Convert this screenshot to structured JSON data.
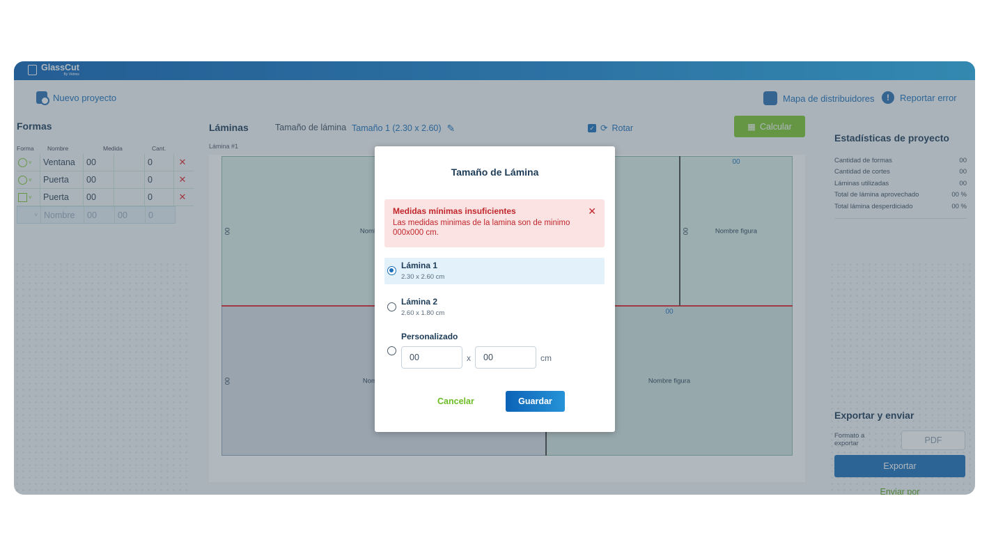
{
  "app": {
    "name": "GlassCut",
    "tagline": "By Vidrios"
  },
  "toolbar": {
    "new_project": "Nuevo proyecto",
    "distributors_map": "Mapa de distribuidores",
    "report_error": "Reportar error"
  },
  "formas": {
    "title": "Formas",
    "headers": {
      "forma": "Forma",
      "nombre": "Nombre",
      "medida": "Medida",
      "cant": "Cant."
    },
    "rows": [
      {
        "shape": "circle",
        "nombre": "Ventana",
        "medida": "00",
        "cant": "0"
      },
      {
        "shape": "circle",
        "nombre": "Puerta",
        "medida": "00",
        "cant": "0"
      },
      {
        "shape": "square",
        "nombre": "Puerta",
        "medida": "00",
        "cant": "0"
      }
    ],
    "new_row": {
      "nombre": "Nombre",
      "medida_a": "00",
      "medida_b": "00",
      "cant": "0"
    }
  },
  "laminas": {
    "title": "Láminas",
    "size_label": "Tamaño de lámina",
    "size_value": "Tamaño 1 (2.30 x 2.60)",
    "rotate": "Rotar",
    "calculate": "Calcular",
    "sheet_label": "Lámina #1",
    "pieces": [
      {
        "top": "00",
        "name": "Nombre figura",
        "side": "00"
      },
      {
        "top": "00",
        "name": "Nombre figura",
        "side": "00"
      },
      {
        "top": "",
        "name": "Nombre figura",
        "side": "00"
      },
      {
        "top": "00",
        "name": "Nombre figura",
        "side": ""
      }
    ]
  },
  "stats": {
    "title": "Estadísticas de proyecto",
    "rows": [
      {
        "label": "Cantidad de formas",
        "value": "00"
      },
      {
        "label": "Cantidad de cortes",
        "value": "00"
      },
      {
        "label": "Láminas utilizadas",
        "value": "00"
      },
      {
        "label": "Total de lámina aprovechado",
        "value": "00 %"
      },
      {
        "label": "Total lámina desperdiciado",
        "value": "00 %"
      }
    ]
  },
  "export": {
    "title": "Exportar y enviar",
    "format_label": "Formato a exportar",
    "format_value": "PDF",
    "export_button": "Exportar",
    "send_by": "Enviar por"
  },
  "modal": {
    "title": "Tamaño de Lámina",
    "alert_title": "Medidas mínimas insuficientes",
    "alert_text": "Las medidas minimas de la lamina son de minimo 000x000 cm.",
    "options": [
      {
        "label": "Lámina 1",
        "sub": "2.30 x 2.60 cm",
        "selected": true
      },
      {
        "label": "Lámina 2",
        "sub": "2.60 x 1.80 cm",
        "selected": false
      }
    ],
    "custom_label": "Personalizado",
    "custom_width": "00",
    "custom_height": "00",
    "x_sep": "x",
    "unit": "cm",
    "cancel": "Cancelar",
    "save": "Guardar"
  },
  "colors": {
    "brand_blue": "#1a6fb8",
    "accent_green": "#7cc42e",
    "error_red": "#c0262b",
    "alert_bg": "#fbe3e3"
  }
}
